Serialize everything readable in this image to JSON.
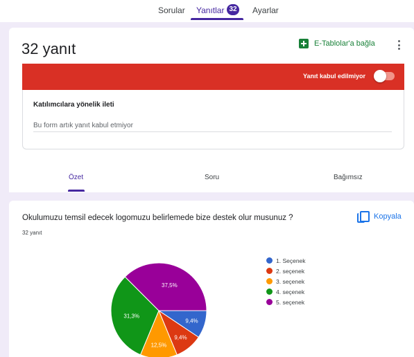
{
  "nav": {
    "tabs": [
      {
        "label": "Sorular"
      },
      {
        "label": "Yanıtlar",
        "badge": "32",
        "active": true
      },
      {
        "label": "Ayarlar"
      }
    ]
  },
  "responses": {
    "title": "32 yanıt",
    "sheets_link": "E-Tablolar'a bağla",
    "more_icon": "more-vert-icon",
    "closed_status": "Yanıt kabul edilmiyor",
    "accepting": false,
    "message_heading": "Katılımcılara yönelik ileti",
    "message_value": "Bu form artık yanıt kabul etmiyor",
    "subtabs": [
      {
        "label": "Özet",
        "active": true
      },
      {
        "label": "Soru"
      },
      {
        "label": "Bağımsız"
      }
    ]
  },
  "question": {
    "title": "Okulumuzu temsil edecek logomuzu belirlemede bize destek olur musunuz ?",
    "count": "32 yanıt",
    "copy_label": "Kopyala",
    "copy_icon": "copy-icon"
  },
  "colors": {
    "accent": "#4527a0",
    "closed_bar": "#d93025",
    "sheets": "#188038",
    "link": "#1a73e8"
  },
  "chart_data": {
    "type": "pie",
    "categories": [
      "1. Seçenek",
      "2. seçenek",
      "3. seçenek",
      "4. seçenek",
      "5. seçenek"
    ],
    "values": [
      9.4,
      9.4,
      12.5,
      31.3,
      37.5
    ],
    "labels": [
      "9,4%",
      "9,4%",
      "12,5%",
      "31,3%",
      "37,5%"
    ],
    "colors": [
      "#3366cc",
      "#dc3912",
      "#ff9900",
      "#109618",
      "#990099"
    ],
    "legend": "right"
  }
}
